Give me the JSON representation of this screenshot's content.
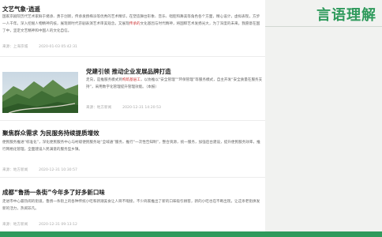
{
  "panel": {
    "title": "言语理解"
  },
  "articles": [
    {
      "title": "文艺气象·逍遥",
      "body": "国家京剧院历代艺术家鲜于绪承、勇于创新，传承发扬梅派等优秀的艺术精华，在塑造舞台形象、音乐、唱腔和舞美等角色各个方面，精心设计，虚拟表现，方步一人千年。深入挖掘人物精神内核，展现新时代京剧表演艺术审美观念，又展现",
      "highlight": "传承的",
      "body_tail": "文化基因与时代精神，将国粹艺术发扬光大，为了深度的未来。我愿意在国了中，坚定文艺精神和中国人的文化自信。",
      "source": "来源：上海京城",
      "date": "2020-01-03 05:42:31"
    },
    {
      "title": "党建引领 推动企业发展品牌打造",
      "body_pre": "走向，是推服务模式到",
      "highlight": "构筑基层工",
      "body_post": "，以协推以“安全管理”“环保管理”等服务模式，自主开发“安全质量在服务支持”，采用数字化管理提升管理效能。（本报）",
      "source": "来源：地方新闻",
      "date": "2020-12-31 14:20:53"
    },
    {
      "title": "聚焦群众需求 为民服务持续提质增效",
      "body": "便民服务推进“标准化”，深化便民服务中心与村级便民服务站“全域通”服务，推行“一次性告知制”，整合资源，统一服务，加强后台建设，提升便民服务效率，推行网格化管理，全面建设人民满意的服务型乡镇。",
      "source": "来源：地方新闻",
      "date": "2020-12-31 10:30:57"
    },
    {
      "title": "成都“鲁扬一条街”今年多了好多新口味",
      "body": "走进市中心最热闹的街道，鲁扬一条街上的各种传统小吃和新潮美食让人目不暇接，不少商家推出了新的口味吸引顾客，新的小吃也在不断出现，让这条老街焕发新的活力，热闹非凡。",
      "source": "来源：地方新闻",
      "date": "2020-12-31 09:13:12"
    }
  ]
}
